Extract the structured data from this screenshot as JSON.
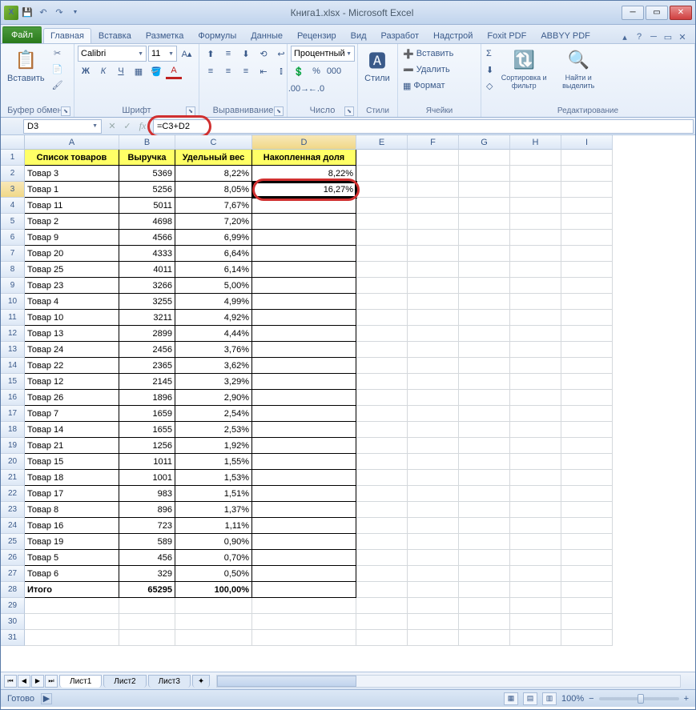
{
  "title": "Книга1.xlsx - Microsoft Excel",
  "qa": {
    "save": "💾",
    "undo": "↶",
    "redo": "↷"
  },
  "win": {
    "min": "─",
    "max": "▭",
    "close": "✕"
  },
  "tabs": {
    "file": "Файл",
    "home": "Главная",
    "insert": "Вставка",
    "layout": "Разметка",
    "formulas": "Формулы",
    "data": "Данные",
    "review": "Рецензир",
    "view": "Вид",
    "dev": "Разработ",
    "addins": "Надстрой",
    "foxit": "Foxit PDF",
    "abbyy": "ABBYY PDF"
  },
  "help": {
    "q": "?",
    "up": "▴",
    "min": "─",
    "x": "✕"
  },
  "ribbon": {
    "clipboard": {
      "label": "Буфер обмена",
      "paste": "Вставить",
      "cut": "✂",
      "copy": "📄",
      "brush": "🖌"
    },
    "font": {
      "label": "Шрифт",
      "name": "Calibri",
      "size": "11",
      "bold": "Ж",
      "italic": "К",
      "underline": "Ч",
      "border": "▦",
      "fill": "🪣",
      "color": "A"
    },
    "align": {
      "label": "Выравнивание"
    },
    "number": {
      "label": "Число",
      "format": "Процентный"
    },
    "styles": {
      "label": "Стили",
      "btn": "Стили"
    },
    "cells": {
      "label": "Ячейки",
      "insert": "Вставить",
      "delete": "Удалить",
      "format": "Формат"
    },
    "editing": {
      "label": "Редактирование",
      "sort": "Сортировка и фильтр",
      "find": "Найти и выделить",
      "sum": "Σ",
      "fill": "⬇",
      "clear": "◇"
    }
  },
  "namebox": "D3",
  "formula": "=C3+D2",
  "cols": [
    "A",
    "B",
    "C",
    "D",
    "E",
    "F",
    "G",
    "H",
    "I"
  ],
  "headers": {
    "a": "Список товаров",
    "b": "Выручка",
    "c": "Удельный вес",
    "d": "Накопленная доля"
  },
  "rows": [
    {
      "n": 2,
      "a": "Товар 3",
      "b": "5369",
      "c": "8,22%",
      "d": "8,22%"
    },
    {
      "n": 3,
      "a": "Товар 1",
      "b": "5256",
      "c": "8,05%",
      "d": "16,27%"
    },
    {
      "n": 4,
      "a": "Товар 11",
      "b": "5011",
      "c": "7,67%",
      "d": ""
    },
    {
      "n": 5,
      "a": "Товар 2",
      "b": "4698",
      "c": "7,20%",
      "d": ""
    },
    {
      "n": 6,
      "a": "Товар 9",
      "b": "4566",
      "c": "6,99%",
      "d": ""
    },
    {
      "n": 7,
      "a": "Товар 20",
      "b": "4333",
      "c": "6,64%",
      "d": ""
    },
    {
      "n": 8,
      "a": "Товар 25",
      "b": "4011",
      "c": "6,14%",
      "d": ""
    },
    {
      "n": 9,
      "a": "Товар 23",
      "b": "3266",
      "c": "5,00%",
      "d": ""
    },
    {
      "n": 10,
      "a": "Товар 4",
      "b": "3255",
      "c": "4,99%",
      "d": ""
    },
    {
      "n": 11,
      "a": "Товар 10",
      "b": "3211",
      "c": "4,92%",
      "d": ""
    },
    {
      "n": 12,
      "a": "Товар 13",
      "b": "2899",
      "c": "4,44%",
      "d": ""
    },
    {
      "n": 13,
      "a": "Товар 24",
      "b": "2456",
      "c": "3,76%",
      "d": ""
    },
    {
      "n": 14,
      "a": "Товар 22",
      "b": "2365",
      "c": "3,62%",
      "d": ""
    },
    {
      "n": 15,
      "a": "Товар 12",
      "b": "2145",
      "c": "3,29%",
      "d": ""
    },
    {
      "n": 16,
      "a": "Товар 26",
      "b": "1896",
      "c": "2,90%",
      "d": ""
    },
    {
      "n": 17,
      "a": "Товар 7",
      "b": "1659",
      "c": "2,54%",
      "d": ""
    },
    {
      "n": 18,
      "a": "Товар 14",
      "b": "1655",
      "c": "2,53%",
      "d": ""
    },
    {
      "n": 19,
      "a": "Товар 21",
      "b": "1256",
      "c": "1,92%",
      "d": ""
    },
    {
      "n": 20,
      "a": "Товар 15",
      "b": "1011",
      "c": "1,55%",
      "d": ""
    },
    {
      "n": 21,
      "a": "Товар 18",
      "b": "1001",
      "c": "1,53%",
      "d": ""
    },
    {
      "n": 22,
      "a": "Товар 17",
      "b": "983",
      "c": "1,51%",
      "d": ""
    },
    {
      "n": 23,
      "a": "Товар 8",
      "b": "896",
      "c": "1,37%",
      "d": ""
    },
    {
      "n": 24,
      "a": "Товар 16",
      "b": "723",
      "c": "1,11%",
      "d": ""
    },
    {
      "n": 25,
      "a": "Товар 19",
      "b": "589",
      "c": "0,90%",
      "d": ""
    },
    {
      "n": 26,
      "a": "Товар 5",
      "b": "456",
      "c": "0,70%",
      "d": ""
    },
    {
      "n": 27,
      "a": "Товар 6",
      "b": "329",
      "c": "0,50%",
      "d": ""
    }
  ],
  "total": {
    "n": 28,
    "a": "Итого",
    "b": "65295",
    "c": "100,00%"
  },
  "sheets": {
    "s1": "Лист1",
    "s2": "Лист2",
    "s3": "Лист3"
  },
  "status": {
    "ready": "Готово",
    "zoom": "100%",
    "macro": "▶"
  }
}
